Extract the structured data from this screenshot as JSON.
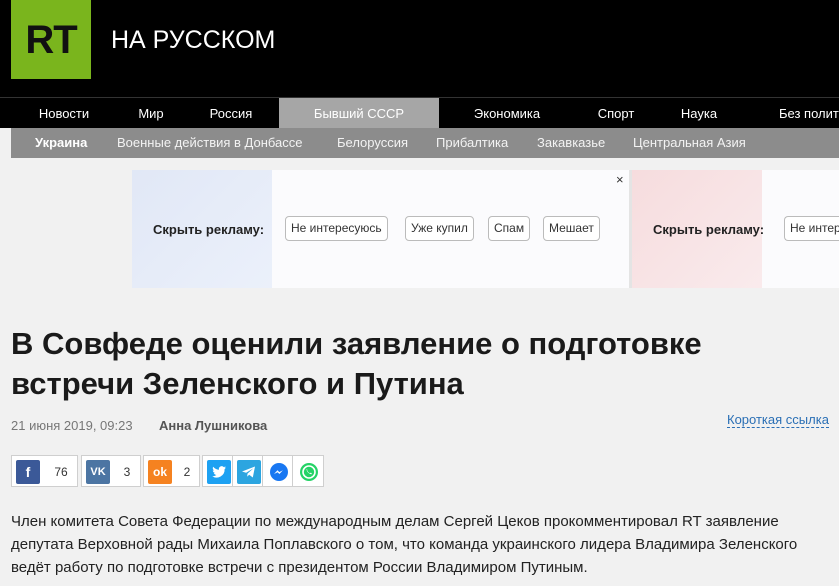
{
  "header": {
    "logo_text": "RT",
    "site_title": "НА РУССКОМ"
  },
  "mainnav": {
    "items": [
      "Новости",
      "Мир",
      "Россия",
      "Бывший СССР",
      "Экономика",
      "Спорт",
      "Наука",
      "Без полити"
    ],
    "active_index": 3
  },
  "subnav": {
    "items": [
      "Украина",
      "Военные действия в Донбассе",
      "Белоруссия",
      "Прибалтика",
      "Закавказье",
      "Центральная Азия"
    ]
  },
  "ad": {
    "close": "×",
    "hide_label": "Скрыть рекламу:",
    "buttons": [
      "Не интересуюсь",
      "Уже купил",
      "Спам",
      "Мешает"
    ],
    "hide_label_2": "Скрыть рекламу:",
    "button_2": "Не интер"
  },
  "article": {
    "headline": "В Совфеде оценили заявление о подготовке встречи Зеленского и Путина",
    "date": "21 июня 2019, 09:23",
    "author": "Анна Лушникова",
    "shortlink": "Короткая ссылка",
    "body": "Член комитета Совета Федерации по международным делам Сергей Цеков прокомментировал RT заявление депутата Верховной рады Михаила Поплавского о том, что команда украинского лидера Владимира Зеленского ведёт работу по подготовке встречи с президентом России Владимиром Путиным."
  },
  "share": {
    "facebook": {
      "icon": "f",
      "count": "76",
      "color": "#3b5998"
    },
    "vk": {
      "icon": "VK",
      "count": "3",
      "color": "#4c75a3"
    },
    "ok": {
      "icon": "ok",
      "count": "2",
      "color": "#f58220"
    },
    "twitter": {
      "icon": "twitter",
      "color": "#1da1f2"
    },
    "telegram": {
      "icon": "telegram",
      "color": "#2ca5e0"
    },
    "messenger": {
      "icon": "messenger",
      "color": "#1877f2"
    },
    "whatsapp": {
      "icon": "whatsapp",
      "color": "#25d366"
    }
  }
}
